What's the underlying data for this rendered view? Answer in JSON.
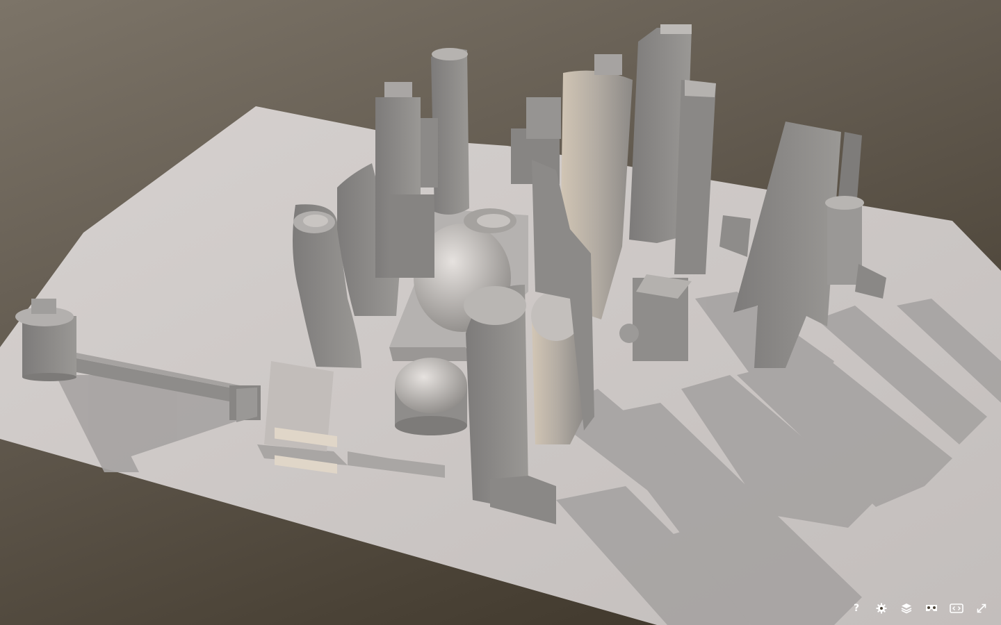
{
  "viewer": {
    "background_top": "#7c7468",
    "background_bottom": "#3a3226",
    "ground_color": "#cfc9c6",
    "building_color": "#8e8c8a"
  },
  "controls": [
    {
      "name": "help-button",
      "icon": "question-mark-icon",
      "label": "?"
    },
    {
      "name": "settings-button",
      "icon": "gear-icon"
    },
    {
      "name": "layers-button",
      "icon": "layers-icon"
    },
    {
      "name": "vr-button",
      "icon": "vr-headset-icon"
    },
    {
      "name": "embed-button",
      "icon": "embed-code-icon"
    },
    {
      "name": "fullscreen-button",
      "icon": "fullscreen-icon"
    }
  ],
  "icon_color": "#ffffff"
}
